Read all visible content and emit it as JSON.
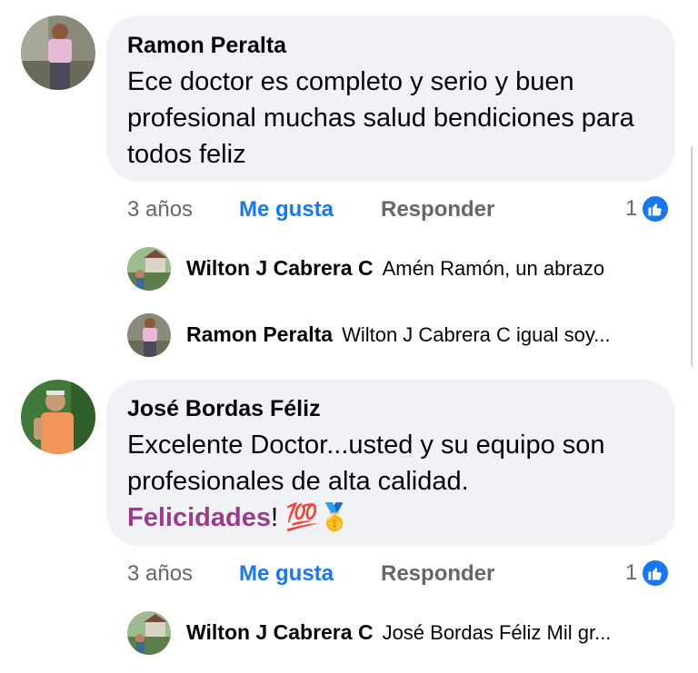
{
  "comments": [
    {
      "author": "Ramon Peralta",
      "text": "Ece doctor es completo y serio y buen profesional muchas salud bendiciones para todos feliz",
      "time": "3 años",
      "like_label": "Me gusta",
      "reply_label": "Responder",
      "reaction_count": "1",
      "replies": [
        {
          "author": "Wilton J Cabrera C",
          "text": "Amén Ramón, un abrazo"
        },
        {
          "author": "Ramon Peralta",
          "text": "Wilton J Cabrera C igual soy..."
        }
      ]
    },
    {
      "author": "José Bordas Féliz",
      "text_line1": "Excelente Doctor...usted y su equipo son",
      "text_line2": "profesionales de alta calidad.",
      "highlight": "Felicidades",
      "text_suffix": "! 💯🥇",
      "time": "3 años",
      "like_label": "Me gusta",
      "reply_label": "Responder",
      "reaction_count": "1",
      "replies": [
        {
          "author": "Wilton J Cabrera C",
          "text": "José Bordas Féliz Mil gr..."
        }
      ]
    }
  ],
  "colors": {
    "like": "#1877f2",
    "bubble": "#f0f2f5",
    "meta": "#65676b",
    "highlight": "#9b3b8b"
  },
  "icons": [
    "like-thumb-icon"
  ]
}
